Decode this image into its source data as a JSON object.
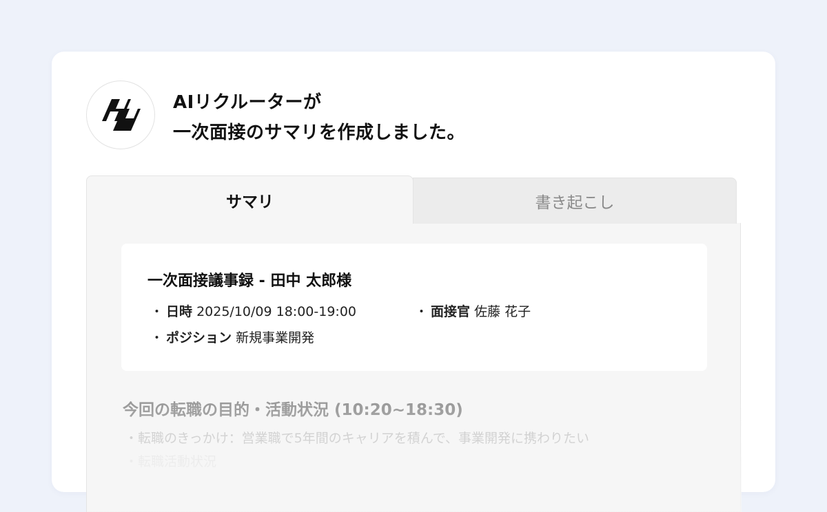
{
  "header": {
    "logo_icon": "recruiter-logo-icon",
    "title_line1": "AIリクルーターが",
    "title_line2": "一次面接のサマリを作成しました。"
  },
  "tabs": [
    {
      "label": "サマリ",
      "active": true
    },
    {
      "label": "書き起こし",
      "active": false
    }
  ],
  "minutes": {
    "title": "一次面接議事録 - 田中 太郎様",
    "datetime_label": "日時",
    "datetime_value": "2025/10/09 18:00-19:00",
    "interviewer_label": "面接官",
    "interviewer_value": "佐藤 花子",
    "position_label": "ポジション",
    "position_value": "新規事業開発"
  },
  "section": {
    "title": "今回の転職の目的・活動状況 (10:20~18:30)",
    "line1": "・転職のきっかけ：営業職で5年間のキャリアを積んで、事業開発に携わりたい",
    "line2": "・転職活動状況"
  },
  "colors": {
    "page_background": "#eef2fa",
    "card_background": "#ffffff",
    "panel_background": "#f6f6f6",
    "inactive_tab": "#ececec"
  }
}
